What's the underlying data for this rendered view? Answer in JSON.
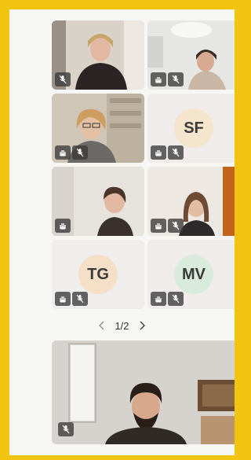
{
  "participants": [
    {
      "type": "video",
      "name": "",
      "muted": true
    },
    {
      "type": "video",
      "name": "",
      "muted": true
    },
    {
      "type": "video",
      "name": "",
      "muted": true
    },
    {
      "type": "avatar",
      "initials": "SF",
      "muted": true
    },
    {
      "type": "video",
      "name": "",
      "muted": true,
      "active": true
    },
    {
      "type": "video",
      "name": "",
      "muted": true
    },
    {
      "type": "avatar",
      "initials": "TG",
      "muted": true
    },
    {
      "type": "avatar",
      "initials": "MV",
      "muted": true
    }
  ],
  "pager": {
    "current_total": "1/2",
    "prev_icon": "chevron-left-icon",
    "next_icon": "chevron-right-icon"
  },
  "self_view": {
    "muted": true
  },
  "colors": {
    "frame": "#f1c40f",
    "active_outline": "#e0a30b",
    "sf_avatar": "#f4e5cc",
    "tg_avatar": "#f5dfc6",
    "mv_avatar": "#d9ebdd"
  },
  "icons": [
    "mic-off-icon",
    "raise-hand-icon"
  ]
}
